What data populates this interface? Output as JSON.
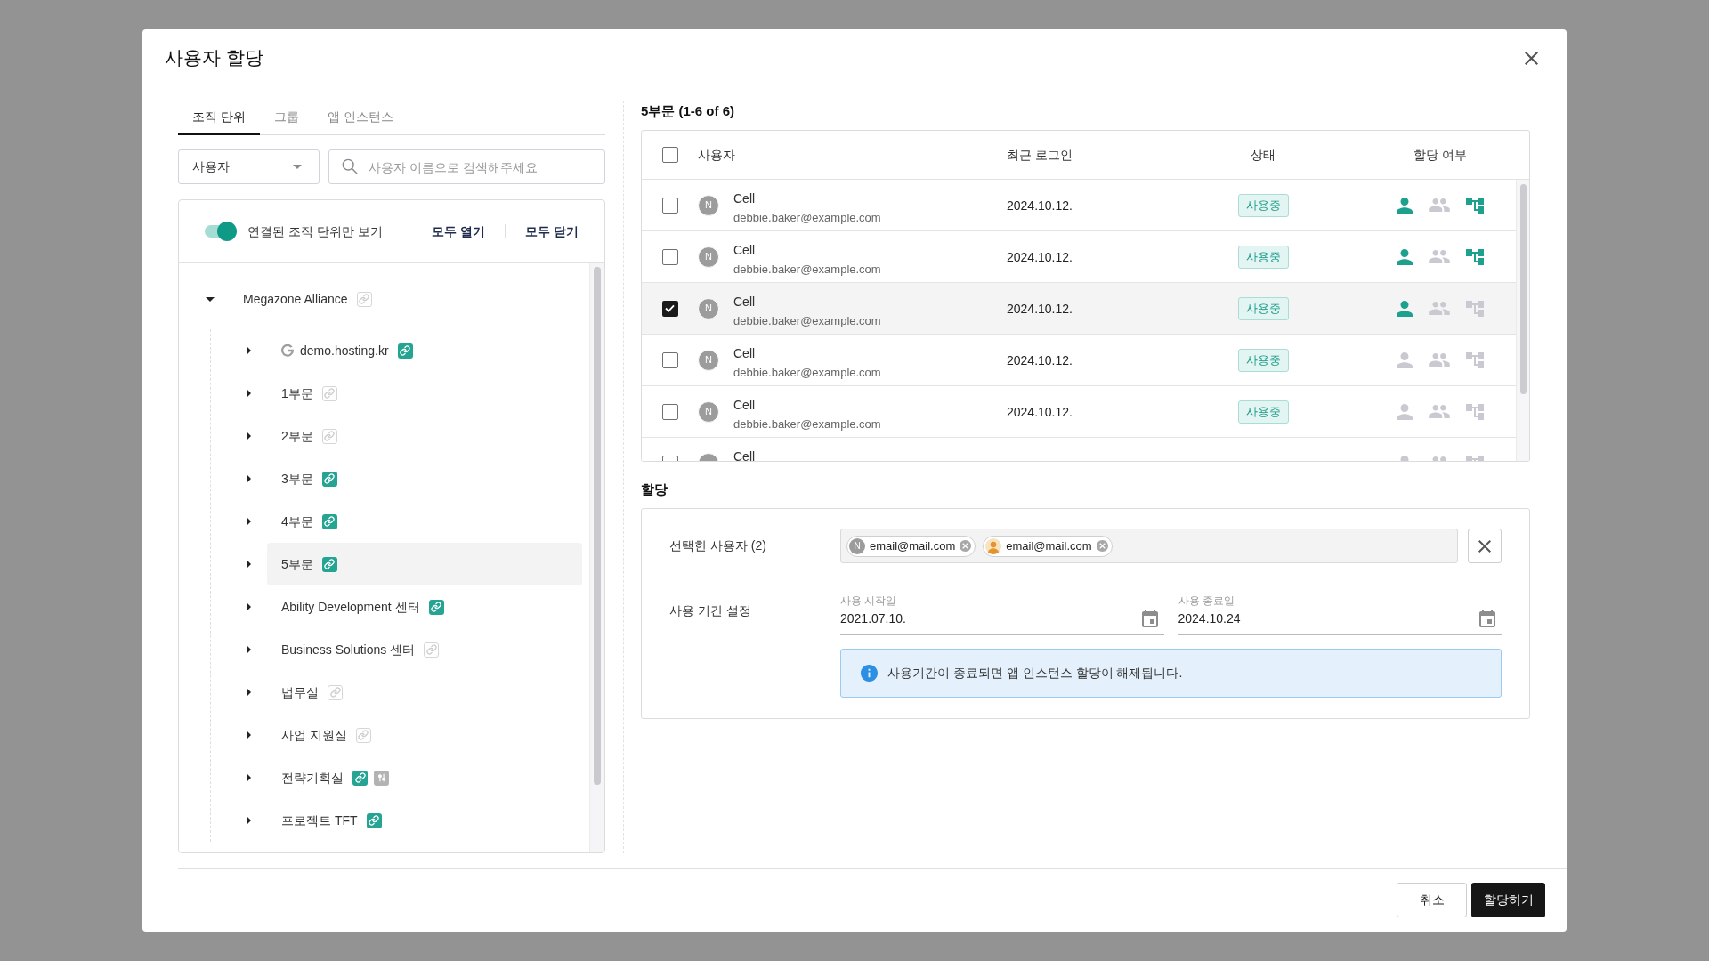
{
  "dialog": {
    "title": "사용자 할당"
  },
  "tabs": [
    {
      "label": "조직 단위",
      "selected": true
    },
    {
      "label": "그룹",
      "selected": false
    },
    {
      "label": "앱 인스턴스",
      "selected": false
    }
  ],
  "filters": {
    "type_select": {
      "value": "사용자"
    },
    "search": {
      "placeholder": "사용자 이름으로 검색해주세요"
    }
  },
  "tree_panel": {
    "toggle": {
      "label": "연결된 조직 단위만 보기",
      "on": true
    },
    "expand_all": "모두 열기",
    "collapse_all": "모두 닫기",
    "tree": [
      {
        "label": "Megazone Alliance",
        "kind": "unit",
        "linked": false,
        "has_settings": false,
        "selected": false,
        "expanded": true,
        "children": [
          {
            "label": "demo.hosting.kr",
            "kind": "domain",
            "linked": true,
            "has_settings": false,
            "selected": false,
            "expanded": false
          },
          {
            "label": "1부문",
            "kind": "unit",
            "linked": false,
            "has_settings": false,
            "selected": false,
            "expanded": false
          },
          {
            "label": "2부문",
            "kind": "unit",
            "linked": false,
            "has_settings": false,
            "selected": false,
            "expanded": false
          },
          {
            "label": "3부문",
            "kind": "unit",
            "linked": true,
            "has_settings": false,
            "selected": false,
            "expanded": false
          },
          {
            "label": "4부문",
            "kind": "unit",
            "linked": true,
            "has_settings": false,
            "selected": false,
            "expanded": false
          },
          {
            "label": "5부문",
            "kind": "unit",
            "linked": true,
            "has_settings": false,
            "selected": true,
            "expanded": false
          },
          {
            "label": "Ability Development 센터",
            "kind": "unit",
            "linked": true,
            "has_settings": false,
            "selected": false,
            "expanded": false
          },
          {
            "label": "Business Solutions 센터",
            "kind": "unit",
            "linked": false,
            "has_settings": false,
            "selected": false,
            "expanded": false
          },
          {
            "label": "법무실",
            "kind": "unit",
            "linked": false,
            "has_settings": false,
            "selected": false,
            "expanded": false
          },
          {
            "label": "사업 지원실",
            "kind": "unit",
            "linked": false,
            "has_settings": false,
            "selected": false,
            "expanded": false
          },
          {
            "label": "전략기획실",
            "kind": "unit",
            "linked": true,
            "has_settings": true,
            "selected": false,
            "expanded": false
          },
          {
            "label": "프로젝트 TFT",
            "kind": "unit",
            "linked": true,
            "has_settings": false,
            "selected": false,
            "expanded": false
          }
        ]
      }
    ]
  },
  "user_list": {
    "title": "5부문 (1-6 of 6)",
    "all_selected": false,
    "columns": [
      "사용자",
      "최근 로그인",
      "상태",
      "할당 여부"
    ],
    "rows": [
      {
        "selected": false,
        "avatar": "N",
        "name": "Cell",
        "email": "debbie.baker@example.com",
        "last_login": "2024.10.12.",
        "status": "사용중",
        "user_assigned": true,
        "group_assigned": false,
        "unit_assigned": true
      },
      {
        "selected": false,
        "avatar": "N",
        "name": "Cell",
        "email": "debbie.baker@example.com",
        "last_login": "2024.10.12.",
        "status": "사용중",
        "user_assigned": true,
        "group_assigned": false,
        "unit_assigned": true
      },
      {
        "selected": true,
        "avatar": "N",
        "name": "Cell",
        "email": "debbie.baker@example.com",
        "last_login": "2024.10.12.",
        "status": "사용중",
        "user_assigned": true,
        "group_assigned": false,
        "unit_assigned": false
      },
      {
        "selected": false,
        "avatar": "N",
        "name": "Cell",
        "email": "debbie.baker@example.com",
        "last_login": "2024.10.12.",
        "status": "사용중",
        "user_assigned": false,
        "group_assigned": false,
        "unit_assigned": false
      },
      {
        "selected": false,
        "avatar": "N",
        "name": "Cell",
        "email": "debbie.baker@example.com",
        "last_login": "2024.10.12.",
        "status": "사용중",
        "user_assigned": false,
        "group_assigned": false,
        "unit_assigned": false
      },
      {
        "selected": false,
        "name": "Cell",
        "user_assigned": false,
        "group_assigned": false,
        "unit_assigned": false
      }
    ]
  },
  "assignment": {
    "title": "할당",
    "selected_users": {
      "label": "선택한 사용자 (2)",
      "chips": [
        {
          "kind": "initial",
          "avatar": "N",
          "email": "email@mail.com"
        },
        {
          "kind": "photo",
          "email": "email@mail.com"
        }
      ]
    },
    "period": {
      "label": "사용 기간 설정",
      "start": {
        "label": "사용 시작일",
        "value": "2021.07.10."
      },
      "end": {
        "label": "사용 종료일",
        "value": "2024.10.24"
      }
    },
    "notice": "사용기간이 종료되면 앱 인스턴스 할당이 해제됩니다."
  },
  "footer": {
    "buttons": [
      {
        "label": "취소",
        "kind": "secondary"
      },
      {
        "label": "할당하기",
        "kind": "primary"
      }
    ]
  }
}
